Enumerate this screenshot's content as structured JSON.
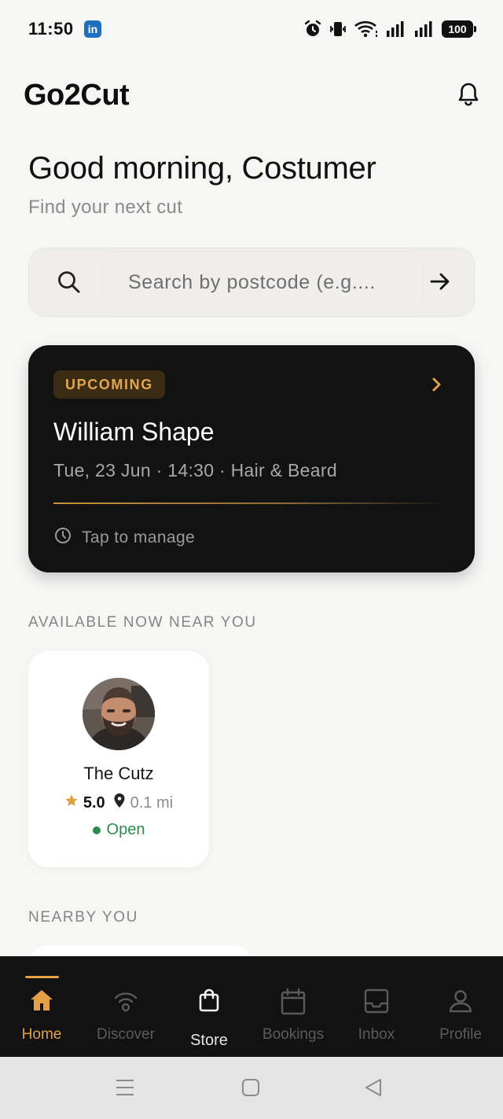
{
  "status_bar": {
    "time": "11:50",
    "app_badge": "in",
    "battery": "100"
  },
  "header": {
    "app_title": "Go2Cut"
  },
  "greeting": {
    "title": "Good morning, Costumer",
    "subtitle": "Find your next cut"
  },
  "search": {
    "placeholder": "Search by postcode (e.g...."
  },
  "upcoming": {
    "badge": "UPCOMING",
    "name": "William Shape",
    "details": "Tue, 23 Jun · 14:30 · Hair & Beard",
    "manage_label": "Tap to manage"
  },
  "available_section": {
    "label": "AVAILABLE NOW NEAR YOU",
    "shops": [
      {
        "name": "The Cutz",
        "rating": "5.0",
        "distance": "0.1 mi",
        "status": "Open"
      }
    ]
  },
  "nearby_section": {
    "label": "NEARBY YOU"
  },
  "bottom_nav": {
    "items": [
      {
        "label": "Home",
        "icon": "home-icon",
        "active": true
      },
      {
        "label": "Discover",
        "icon": "signal-icon",
        "active": false
      },
      {
        "label": "Store",
        "icon": "shopping-bag-icon",
        "active": false
      },
      {
        "label": "Bookings",
        "icon": "calendar-icon",
        "active": false
      },
      {
        "label": "Inbox",
        "icon": "inbox-icon",
        "active": false
      },
      {
        "label": "Profile",
        "icon": "user-icon",
        "active": false
      }
    ]
  },
  "colors": {
    "accent": "#e2a048",
    "card_dark": "#131212",
    "open_green": "#2c8a4f",
    "background": "#f6f6f5"
  }
}
